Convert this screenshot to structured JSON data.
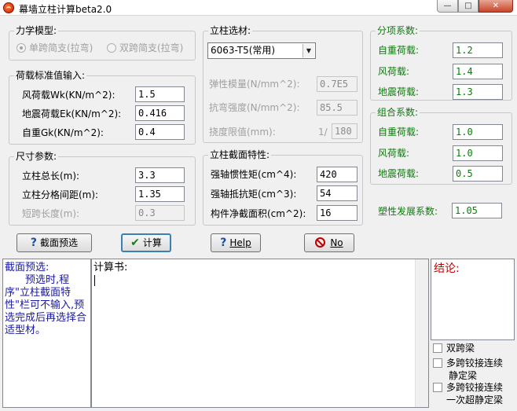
{
  "window": {
    "title": "幕墙立柱计算beta2.0",
    "min_glyph": "—",
    "max_glyph": "□",
    "close_glyph": "✕"
  },
  "mechanics": {
    "title": "力学模型:",
    "opt_simple": "单跨简支(拉弯)",
    "opt_double": "双跨简支(拉弯)"
  },
  "load_std": {
    "title": "荷载标准值输入:",
    "wind_label": "风荷载Wk(KN/m^2):",
    "wind_value": "1.5",
    "quake_label": "地震荷载Ek(KN/m^2):",
    "quake_value": "0.416",
    "self_label": "自重Gk(KN/m^2):",
    "self_value": "0.4"
  },
  "dims": {
    "title": "尺寸参数:",
    "length_label": "立柱总长(m):",
    "length_value": "3.3",
    "spacing_label": "立柱分格间距(m):",
    "spacing_value": "1.35",
    "short_label": "短跨长度(m):",
    "short_value": "0.3"
  },
  "material": {
    "title": "立柱选材:",
    "selected": "6063-T5(常用)",
    "arrow": "▼",
    "modulus_label": "弹性模量(N/mm^2):",
    "modulus_value": "0.7E5",
    "strength_label": "抗弯强度(N/mm^2):",
    "strength_value": "85.5",
    "deflect_label": "挠度限值(mm):",
    "deflect_prefix": "1/",
    "deflect_value": "180"
  },
  "section": {
    "title": "立柱截面特性:",
    "inertia_label": "强轴惯性矩(cm^4):",
    "inertia_value": "420",
    "modulus_label": "强轴抵抗矩(cm^3):",
    "modulus_value": "54",
    "area_label": "构件净截面积(cm^2):",
    "area_value": "16"
  },
  "factors": {
    "title": "分项系数:",
    "self_label": "自重荷载:",
    "self_value": "1.2",
    "wind_label": "风荷载:",
    "wind_value": "1.4",
    "quake_label": "地震荷载:",
    "quake_value": "1.3"
  },
  "combo": {
    "title": "组合系数:",
    "self_label": "自重荷载:",
    "self_value": "1.0",
    "wind_label": "风荷载:",
    "wind_value": "1.0",
    "quake_label": "地震荷载:",
    "quake_value": "0.5"
  },
  "plastic": {
    "label": "塑性发展系数:",
    "value": "1.05"
  },
  "buttons": {
    "preselect": "截面预选",
    "calc": "计算",
    "help": "Help",
    "no": "No",
    "q_glyph": "?",
    "check_glyph": "✔"
  },
  "preselect_pane": {
    "title": "截面预选:",
    "body": "　　预选时,程序\"立柱截面特性\"栏可不输入,预选完成后再选择合适型材。"
  },
  "report_pane": {
    "title": "计算书:"
  },
  "conclusion_pane": {
    "title": "结论:"
  },
  "beam_options": {
    "double_span": "双跨梁",
    "multi_static_1": "多跨铰接连续",
    "multi_static_2": "静定梁",
    "multi_redundant_1": "多跨铰接连续",
    "multi_redundant_2": "一次超静定梁"
  },
  "colors": {
    "green_text": "#0a7d0a",
    "blue_text": "#1a1aa0",
    "red_text": "#c00000"
  }
}
